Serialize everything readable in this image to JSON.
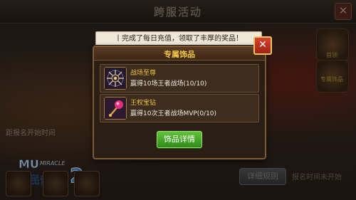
{
  "background": {
    "title": "跨服活动",
    "close_symbol": "✕",
    "side_labels": [
      "首领",
      "专属饰品"
    ],
    "start_time_label": "距报名开始时间",
    "detail_rules_label": "详细规则",
    "not_started_label": "报名时间未开始"
  },
  "notice": {
    "text": "丨完成了每日充值，领取了丰厚的奖品！"
  },
  "popup": {
    "title": "专属饰品",
    "close_symbol": "✕",
    "items": [
      {
        "name": "战场至尊",
        "desc": "赢得10场王者战场(10/10)",
        "icon": "spiked-mace-icon"
      },
      {
        "name": "王权宝钻",
        "desc": "赢得10次王者战场MVP(0/10)",
        "icon": "jeweled-scepter-icon"
      }
    ],
    "detail_button": "饰品详情"
  },
  "colors": {
    "accent_gold": "#f0c040",
    "button_green": "#4aa82a",
    "close_red": "#c0301c"
  }
}
